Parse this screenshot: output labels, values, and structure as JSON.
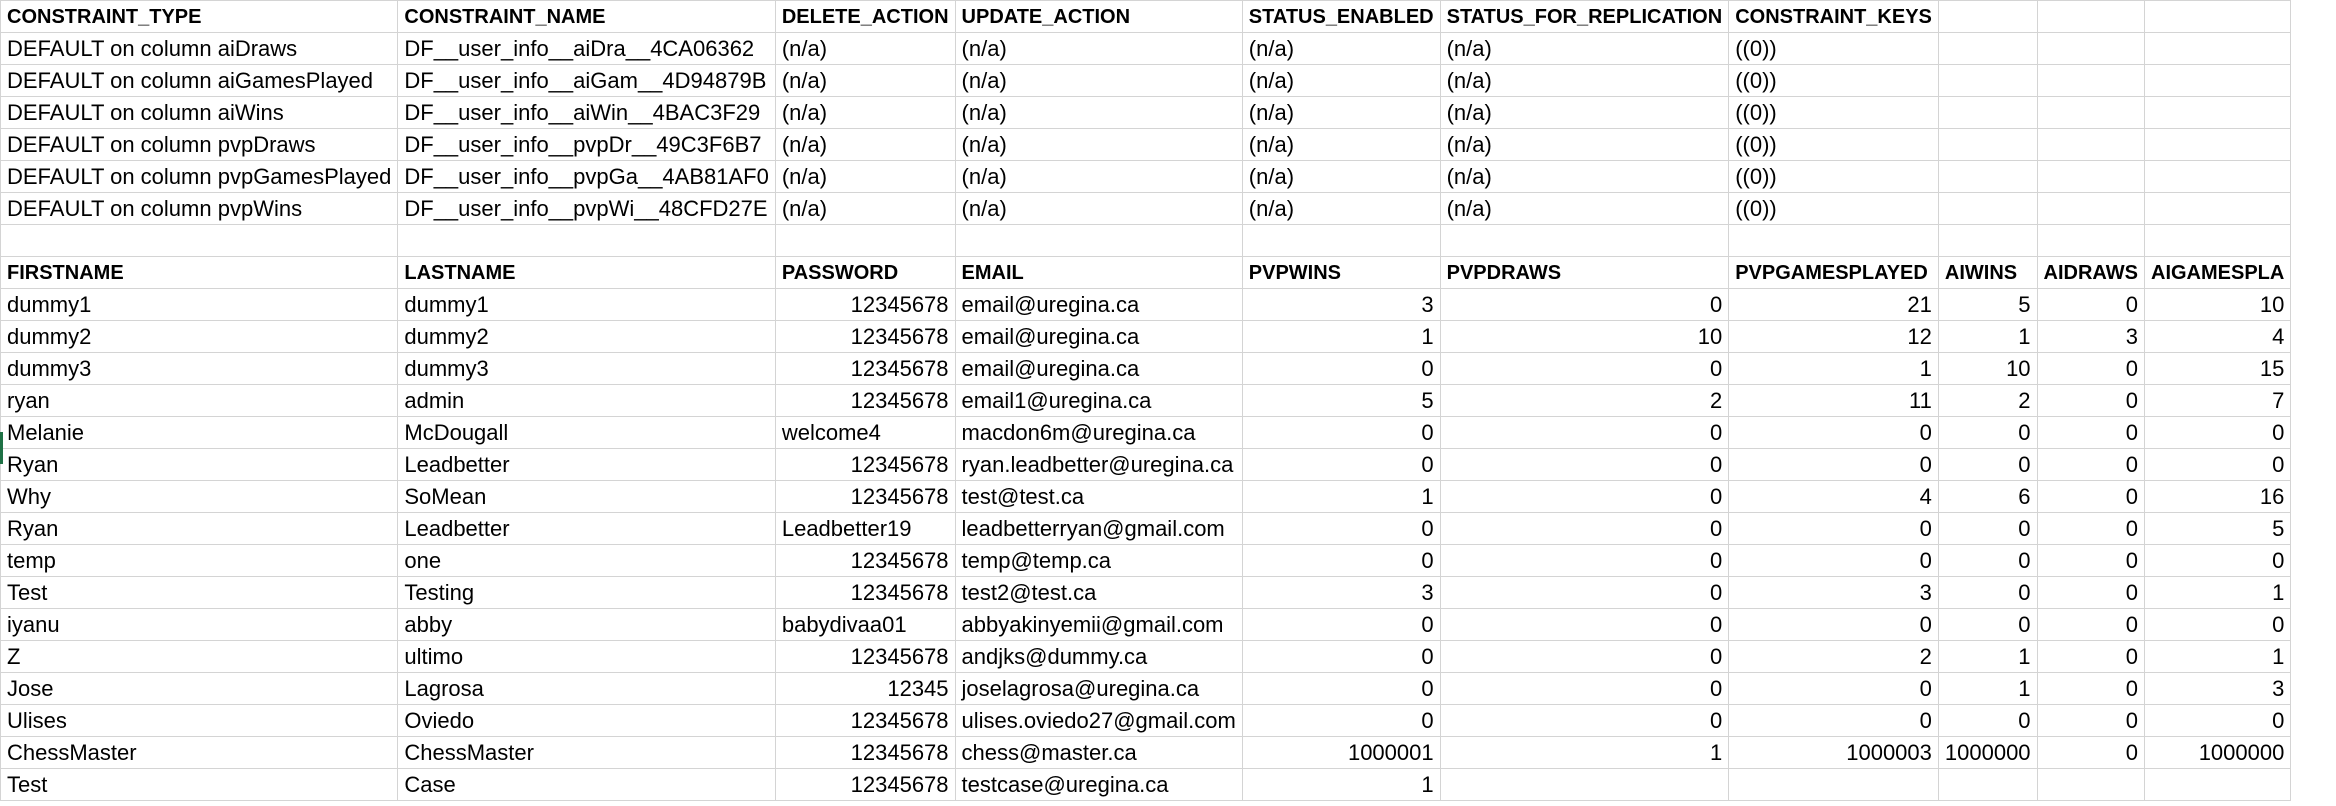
{
  "constraints": {
    "headers": [
      "CONSTRAINT_TYPE",
      "CONSTRAINT_NAME",
      "DELETE_ACTION",
      "UPDATE_ACTION",
      "STATUS_ENABLED",
      "STATUS_FOR_REPLICATION",
      "CONSTRAINT_KEYS",
      "",
      "",
      ""
    ],
    "rows": [
      [
        "DEFAULT on column aiDraws",
        "DF__user_info__aiDra__4CA06362",
        "(n/a)",
        "(n/a)",
        "(n/a)",
        "(n/a)",
        "((0))",
        "",
        "",
        ""
      ],
      [
        "DEFAULT on column aiGamesPlayed",
        "DF__user_info__aiGam__4D94879B",
        "(n/a)",
        "(n/a)",
        "(n/a)",
        "(n/a)",
        "((0))",
        "",
        "",
        ""
      ],
      [
        "DEFAULT on column aiWins",
        "DF__user_info__aiWin__4BAC3F29",
        "(n/a)",
        "(n/a)",
        "(n/a)",
        "(n/a)",
        "((0))",
        "",
        "",
        ""
      ],
      [
        "DEFAULT on column pvpDraws",
        "DF__user_info__pvpDr__49C3F6B7",
        "(n/a)",
        "(n/a)",
        "(n/a)",
        "(n/a)",
        "((0))",
        "",
        "",
        ""
      ],
      [
        "DEFAULT on column pvpGamesPlayed",
        "DF__user_info__pvpGa__4AB81AF0",
        "(n/a)",
        "(n/a)",
        "(n/a)",
        "(n/a)",
        "((0))",
        "",
        "",
        ""
      ],
      [
        "DEFAULT on column pvpWins",
        "DF__user_info__pvpWi__48CFD27E",
        "(n/a)",
        "(n/a)",
        "(n/a)",
        "(n/a)",
        "((0))",
        "",
        "",
        ""
      ]
    ]
  },
  "users": {
    "headers": [
      "FIRSTNAME",
      "LASTNAME",
      "PASSWORD",
      "EMAIL",
      "PVPWINS",
      "PVPDRAWS",
      "PVPGAMESPLAYED",
      "AIWINS",
      "AIDRAWS",
      "AIGAMESPLA"
    ],
    "rows": [
      [
        "dummy1",
        "dummy1",
        "12345678",
        "email@uregina.ca",
        "3",
        "0",
        "21",
        "5",
        "0",
        "10"
      ],
      [
        "dummy2",
        "dummy2",
        "12345678",
        "email@uregina.ca",
        "1",
        "10",
        "12",
        "1",
        "3",
        "4"
      ],
      [
        "dummy3",
        "dummy3",
        "12345678",
        "email@uregina.ca",
        "0",
        "0",
        "1",
        "10",
        "0",
        "15"
      ],
      [
        "ryan",
        "admin",
        "12345678",
        "email1@uregina.ca",
        "5",
        "2",
        "11",
        "2",
        "0",
        "7"
      ],
      [
        "Melanie",
        "McDougall",
        "welcome4",
        "macdon6m@uregina.ca",
        "0",
        "0",
        "0",
        "0",
        "0",
        "0"
      ],
      [
        "Ryan",
        "Leadbetter",
        "12345678",
        "ryan.leadbetter@uregina.ca",
        "0",
        "0",
        "0",
        "0",
        "0",
        "0"
      ],
      [
        "Why",
        "SoMean",
        "12345678",
        "test@test.ca",
        "1",
        "0",
        "4",
        "6",
        "0",
        "16"
      ],
      [
        "Ryan",
        "Leadbetter",
        "Leadbetter19",
        "leadbetterryan@gmail.com",
        "0",
        "0",
        "0",
        "0",
        "0",
        "5"
      ],
      [
        "temp",
        "one",
        "12345678",
        "temp@temp.ca",
        "0",
        "0",
        "0",
        "0",
        "0",
        "0"
      ],
      [
        "Test",
        "Testing",
        "12345678",
        "test2@test.ca",
        "3",
        "0",
        "3",
        "0",
        "0",
        "1"
      ],
      [
        "iyanu",
        "abby",
        "babydivaa01",
        "abbyakinyemii@gmail.com",
        "0",
        "0",
        "0",
        "0",
        "0",
        "0"
      ],
      [
        "Z",
        "ultimo",
        "12345678",
        "andjks@dummy.ca",
        "0",
        "0",
        "2",
        "1",
        "0",
        "1"
      ],
      [
        "Jose",
        "Lagrosa",
        "12345",
        "joselagrosa@uregina.ca",
        "0",
        "0",
        "0",
        "1",
        "0",
        "3"
      ],
      [
        "Ulises",
        "Oviedo",
        "12345678",
        "ulises.oviedo27@gmail.com",
        "0",
        "0",
        "0",
        "0",
        "0",
        "0"
      ],
      [
        "ChessMaster",
        "ChessMaster",
        "12345678",
        "chess@master.ca",
        "1000001",
        "1",
        "1000003",
        "1000000",
        "0",
        "1000000"
      ],
      [
        "Test",
        "Case",
        "12345678",
        "testcase@uregina.ca",
        "1",
        "",
        "",
        "",
        "",
        ""
      ]
    ]
  }
}
